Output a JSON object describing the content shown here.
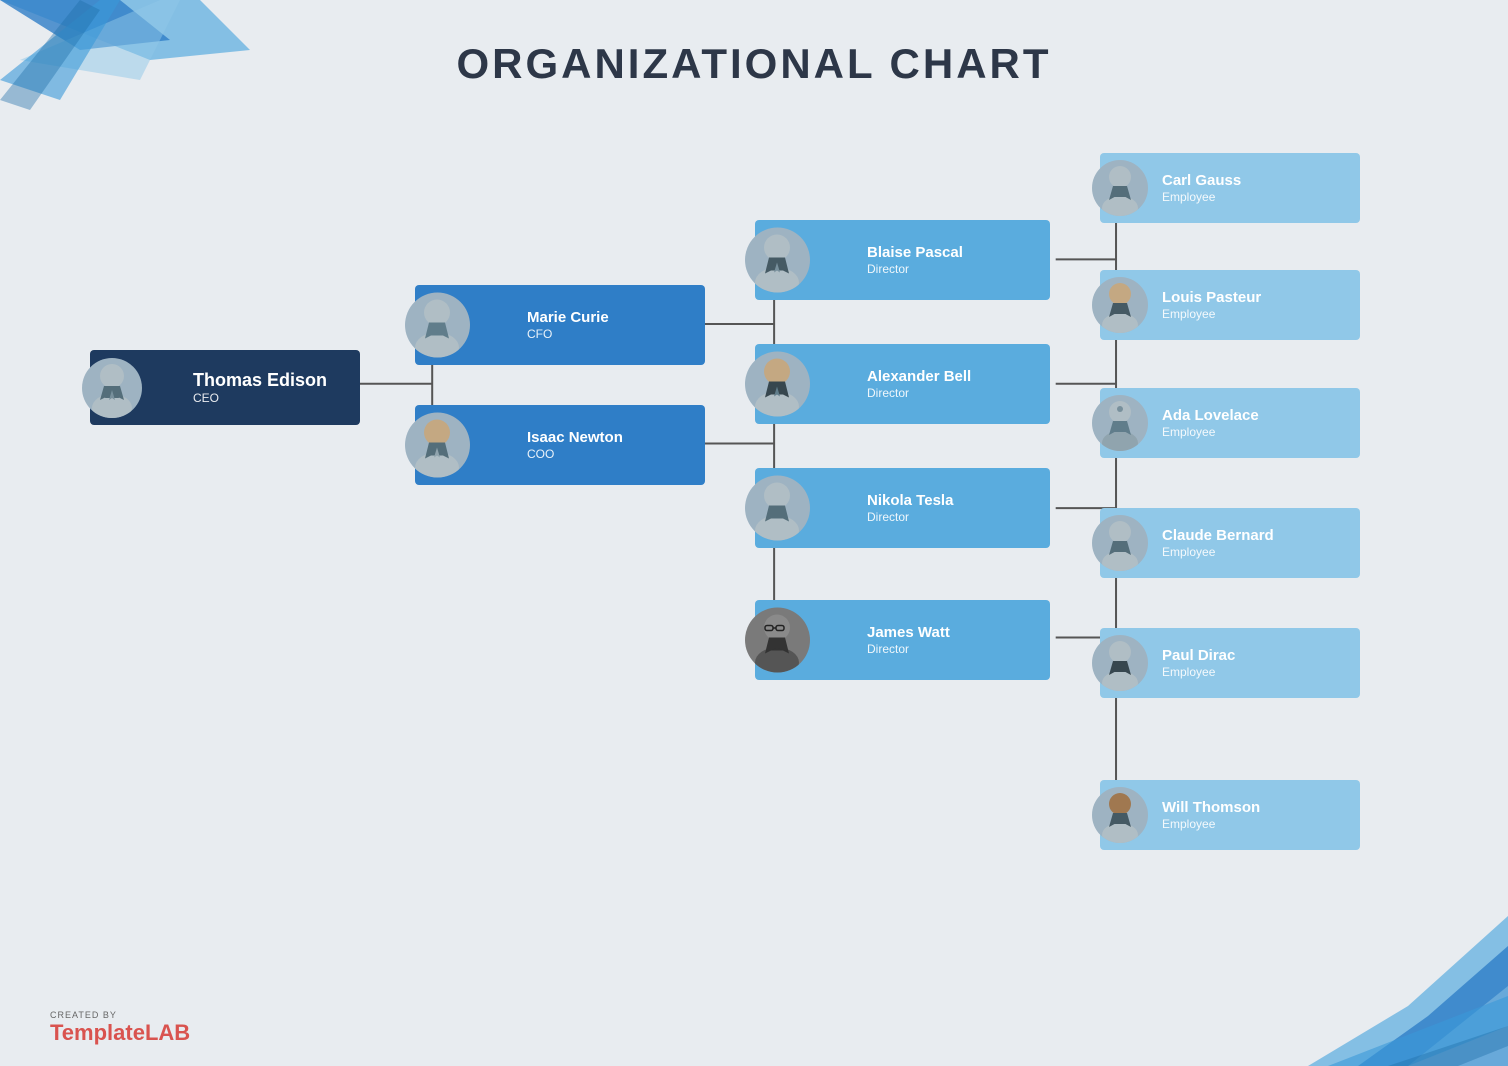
{
  "title": "ORGANIZATIONAL CHART",
  "branding": {
    "created_by": "CREATED BY",
    "name_light": "Template",
    "name_bold": "LAB"
  },
  "nodes": {
    "ceo": {
      "name": "Thomas Edison",
      "role": "CEO"
    },
    "cfo": {
      "name": "Marie Curie",
      "role": "CFO"
    },
    "coo": {
      "name": "Isaac Newton",
      "role": "COO"
    },
    "dir1": {
      "name": "Blaise Pascal",
      "role": "Director"
    },
    "dir2": {
      "name": "Alexander Bell",
      "role": "Director"
    },
    "dir3": {
      "name": "Nikola Tesla",
      "role": "Director"
    },
    "dir4": {
      "name": "James Watt",
      "role": "Director"
    },
    "emp1": {
      "name": "Carl Gauss",
      "role": "Employee"
    },
    "emp2": {
      "name": "Louis Pasteur",
      "role": "Employee"
    },
    "emp3": {
      "name": "Ada Lovelace",
      "role": "Employee"
    },
    "emp4": {
      "name": "Claude Bernard",
      "role": "Employee"
    },
    "emp5": {
      "name": "Paul Dirac",
      "role": "Employee"
    },
    "emp6": {
      "name": "Will Thomson",
      "role": "Employee"
    }
  },
  "colors": {
    "ceo_bg": "#1e3a5f",
    "manager_bg": "#2f7ec7",
    "director_bg": "#5aacde",
    "employee_bg": "#90c8e8",
    "avatar_bg": "#9eb3c2",
    "title_color": "#2d3748",
    "accent": "#2980b9"
  }
}
